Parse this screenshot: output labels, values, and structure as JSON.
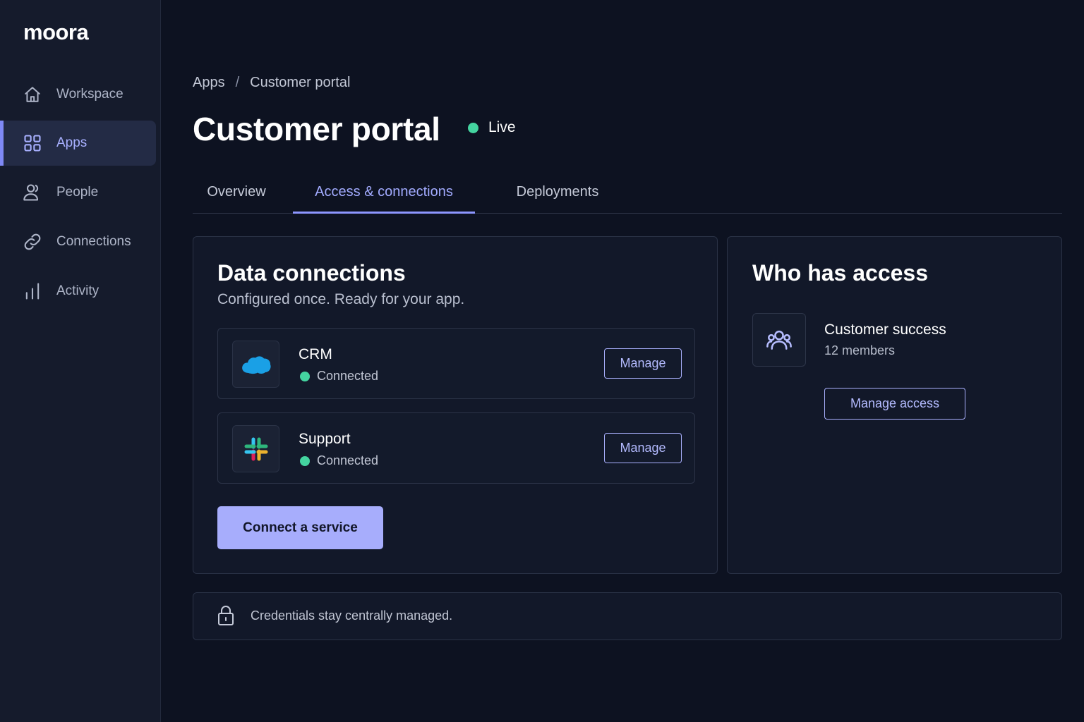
{
  "brand": {
    "logo": "moora"
  },
  "sidebar": {
    "items": [
      {
        "label": "Workspace",
        "icon": "home-icon",
        "active": false
      },
      {
        "label": "Apps",
        "icon": "grid-icon",
        "active": true
      },
      {
        "label": "People",
        "icon": "user-icon",
        "active": false
      },
      {
        "label": "Connections",
        "icon": "link-icon",
        "active": false
      },
      {
        "label": "Activity",
        "icon": "bar-chart-icon",
        "active": false
      }
    ]
  },
  "breadcrumb": {
    "parent": "Apps",
    "separator": "/",
    "current": "Customer portal"
  },
  "header": {
    "title": "Customer portal",
    "status": "Live",
    "status_color": "#44d4a0"
  },
  "tabs": [
    {
      "label": "Overview",
      "active": false
    },
    {
      "label": "Access & connections",
      "active": true
    },
    {
      "label": "Deployments",
      "active": false
    }
  ],
  "data_connections": {
    "title": "Data connections",
    "subtitle": "Configured once. Ready for your app.",
    "items": [
      {
        "name": "CRM",
        "status": "Connected",
        "icon": "cloud-icon",
        "button": "Manage"
      },
      {
        "name": "Support",
        "status": "Connected",
        "icon": "hash-logo-icon",
        "button": "Manage"
      }
    ],
    "primary_button": "Connect a service"
  },
  "access": {
    "title": "Who has access",
    "group": {
      "name": "Customer success",
      "members": "12 members",
      "icon": "users-icon"
    },
    "button": "Manage access"
  },
  "footer": {
    "note": "Credentials stay centrally managed.",
    "icon": "lock-icon"
  },
  "colors": {
    "accent": "#a7adfc",
    "background": "#0d1221",
    "sidebar": "#151b2c",
    "success": "#44d4a0"
  }
}
